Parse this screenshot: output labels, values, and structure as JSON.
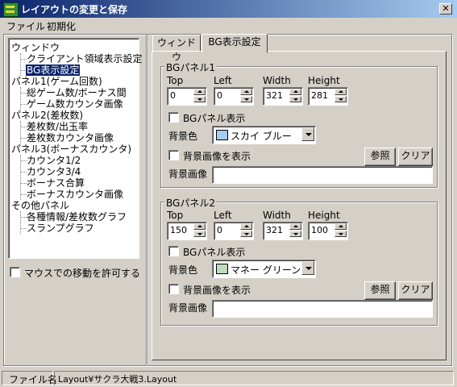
{
  "window": {
    "title": "レイアウトの変更と保存",
    "close_glyph": "✕"
  },
  "menu": [
    "ファイル",
    "初期化"
  ],
  "tree": {
    "items": [
      {
        "label": "ウィンドウ",
        "level": 0
      },
      {
        "label": "クライアント領域表示設定",
        "level": 1
      },
      {
        "label": "BG表示設定",
        "level": 1,
        "selected": true
      },
      {
        "label": "パネル1(ゲーム回数)",
        "level": 0
      },
      {
        "label": "総ゲーム数/ボーナス間",
        "level": 1
      },
      {
        "label": "ゲーム数カウンタ画像",
        "level": 1
      },
      {
        "label": "パネル2(差枚数)",
        "level": 0
      },
      {
        "label": "差枚数/出玉率",
        "level": 1
      },
      {
        "label": "差枚数カウンタ画像",
        "level": 1
      },
      {
        "label": "パネル3(ボーナスカウンタ)",
        "level": 0
      },
      {
        "label": "カウンタ1/2",
        "level": 1
      },
      {
        "label": "カウンタ3/4",
        "level": 1
      },
      {
        "label": "ボーナス合算",
        "level": 1
      },
      {
        "label": "ボーナスカウンタ画像",
        "level": 1
      },
      {
        "label": "その他パネル",
        "level": 0
      },
      {
        "label": "各種情報/差枚数グラフ",
        "level": 1
      },
      {
        "label": "スランプグラフ",
        "level": 1
      }
    ]
  },
  "allow_mouse_move": {
    "label": "マウスでの移動を許可する",
    "checked": false
  },
  "tabs": [
    "ウィンドウ",
    "BG表示設定"
  ],
  "active_tab": "BG表示設定",
  "panel1": {
    "title": "BGパネル1",
    "labels": {
      "top": "Top",
      "left": "Left",
      "width": "Width",
      "height": "Height"
    },
    "values": {
      "top": "0",
      "left": "0",
      "width": "321",
      "height": "281"
    },
    "show_label": "BGパネル表示",
    "bg_color_label": "背景色",
    "bg_color_value": "スカイ ブルー",
    "bg_color_hex": "#a6caf0",
    "show_image_label": "背景画像を表示",
    "browse_label": "参照",
    "clear_label": "クリア",
    "image_label": "背景画像",
    "image_value": ""
  },
  "panel2": {
    "title": "BGパネル2",
    "labels": {
      "top": "Top",
      "left": "Left",
      "width": "Width",
      "height": "Height"
    },
    "values": {
      "top": "150",
      "left": "0",
      "width": "321",
      "height": "100"
    },
    "show_label": "BGパネル表示",
    "bg_color_label": "背景色",
    "bg_color_value": "マネー グリーン",
    "bg_color_hex": "#c0dcc0",
    "show_image_label": "背景画像を表示",
    "browse_label": "参照",
    "clear_label": "クリア",
    "image_label": "背景画像",
    "image_value": ""
  },
  "status": {
    "file_label": "ファイル名",
    "file_value": "Layout¥サクラ大戦3.Layout"
  }
}
